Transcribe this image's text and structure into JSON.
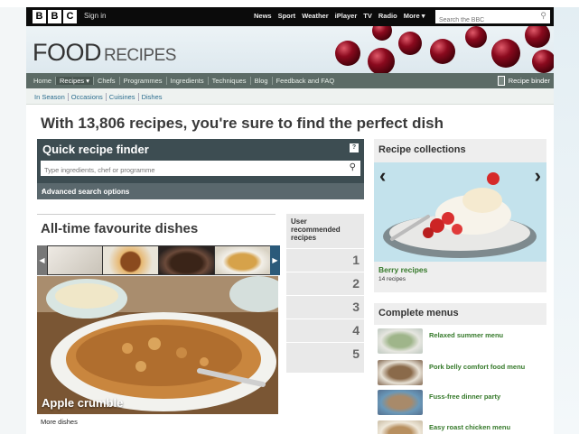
{
  "bbc_bar": {
    "logo_letters": [
      "B",
      "B",
      "C"
    ],
    "signin": "Sign in",
    "nav": [
      "News",
      "Sport",
      "Weather",
      "iPlayer",
      "TV",
      "Radio",
      "More ▾"
    ],
    "search_placeholder": "Search the BBC"
  },
  "masthead": {
    "title_main": "FOOD",
    "title_sub": "RECIPES"
  },
  "main_nav": {
    "items": [
      "Home",
      "Recipes ▾",
      "Chefs",
      "Programmes",
      "Ingredients",
      "Techniques",
      "Blog",
      "Feedback and FAQ"
    ],
    "active_index": 1,
    "binder_label": "Recipe binder"
  },
  "sub_nav": {
    "items": [
      "In Season",
      "Occasions",
      "Cuisines",
      "Dishes"
    ]
  },
  "headline": "With 13,806 recipes, you're sure to find the perfect dish",
  "finder": {
    "title": "Quick recipe finder",
    "help": "?",
    "placeholder": "Type ingredients, chef or programme",
    "advanced": "Advanced search options"
  },
  "favourites": {
    "title": "All-time favourite dishes",
    "hero_caption": "Apple crumble",
    "more": "More dishes",
    "thumb_colors": [
      "#d8d4cc",
      "#b77a3a",
      "#5a3a28",
      "#c99a58"
    ]
  },
  "user_recommended": {
    "title": "User recommended recipes",
    "ranks": [
      "1",
      "2",
      "3",
      "4",
      "5"
    ]
  },
  "collections": {
    "title": "Recipe collections",
    "caption": "Berry recipes",
    "count": "14 recipes"
  },
  "menus": {
    "title": "Complete menus",
    "items": [
      {
        "label": "Relaxed summer menu",
        "color": "#9fb58a"
      },
      {
        "label": "Pork belly comfort food menu",
        "color": "#8a6a4a"
      },
      {
        "label": "Fuss-free dinner party",
        "color": "#a88a6a"
      },
      {
        "label": "Easy roast chicken menu",
        "color": "#b89060"
      }
    ]
  },
  "colors": {
    "nav_green": "#5c6b66",
    "finder_bg": "#3d4d52",
    "link_green": "#35792a"
  }
}
